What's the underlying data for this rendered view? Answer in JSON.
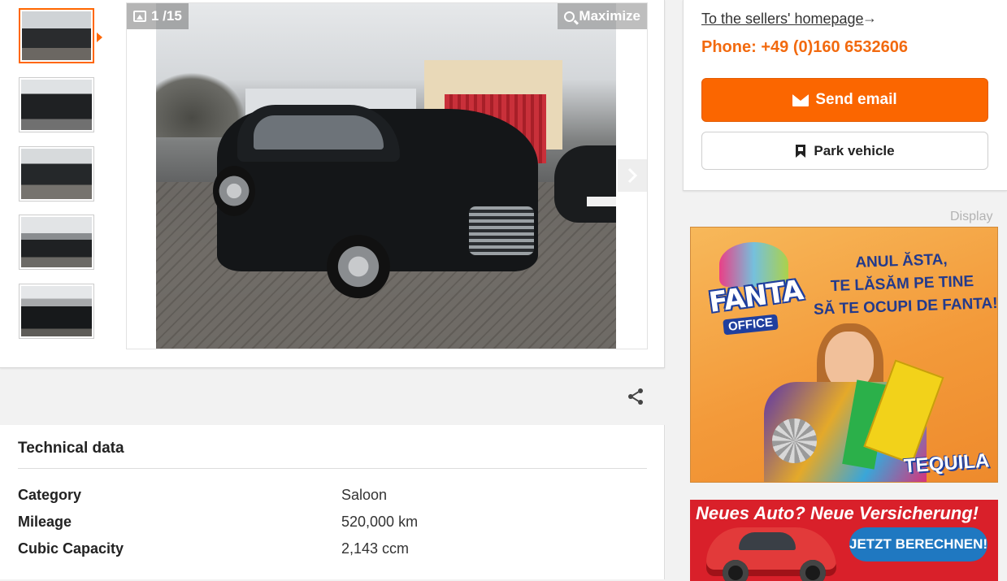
{
  "gallery": {
    "counter": "1 /15",
    "maximize_label": "Maximize",
    "thumbnails": [
      {
        "alt": "thumbnail-1",
        "active": true
      },
      {
        "alt": "thumbnail-2",
        "active": false
      },
      {
        "alt": "thumbnail-3",
        "active": false
      },
      {
        "alt": "thumbnail-4",
        "active": false
      },
      {
        "alt": "thumbnail-5",
        "active": false
      }
    ]
  },
  "technical": {
    "title": "Technical data",
    "rows": [
      {
        "key": "Category",
        "value": "Saloon"
      },
      {
        "key": "Mileage",
        "value": "520,000 km"
      },
      {
        "key": "Cubic Capacity",
        "value": "2,143 ccm"
      }
    ]
  },
  "seller": {
    "homepage_link": "To the sellers' homepage",
    "homepage_arrow": "→",
    "phone": "Phone: +49 (0)160 6532606",
    "send_email_label": "Send email",
    "park_label": "Park vehicle"
  },
  "ads": {
    "display_label": "Display",
    "ad1": {
      "logo": "FANTA",
      "logo_sub": "OFFICE",
      "headline": [
        "ANUL ĂSTA,",
        "TE LĂSĂM PE TINE",
        "SĂ TE OCUPI DE FANTA!"
      ],
      "flavor": "TEQUILA"
    },
    "ad2": {
      "headline": "Neues Auto? Neue Versicherung!",
      "button": "JETZT BERECHNEN!"
    }
  },
  "colors": {
    "accent": "#fb6600",
    "phone": "#f26a0f",
    "ad2_bg": "#d9202a",
    "ad2_button": "#1f78c1"
  },
  "icons": [
    "image-icon",
    "magnifier-icon",
    "chevron-right-icon",
    "share-icon",
    "envelope-icon",
    "bookmark-icon"
  ]
}
